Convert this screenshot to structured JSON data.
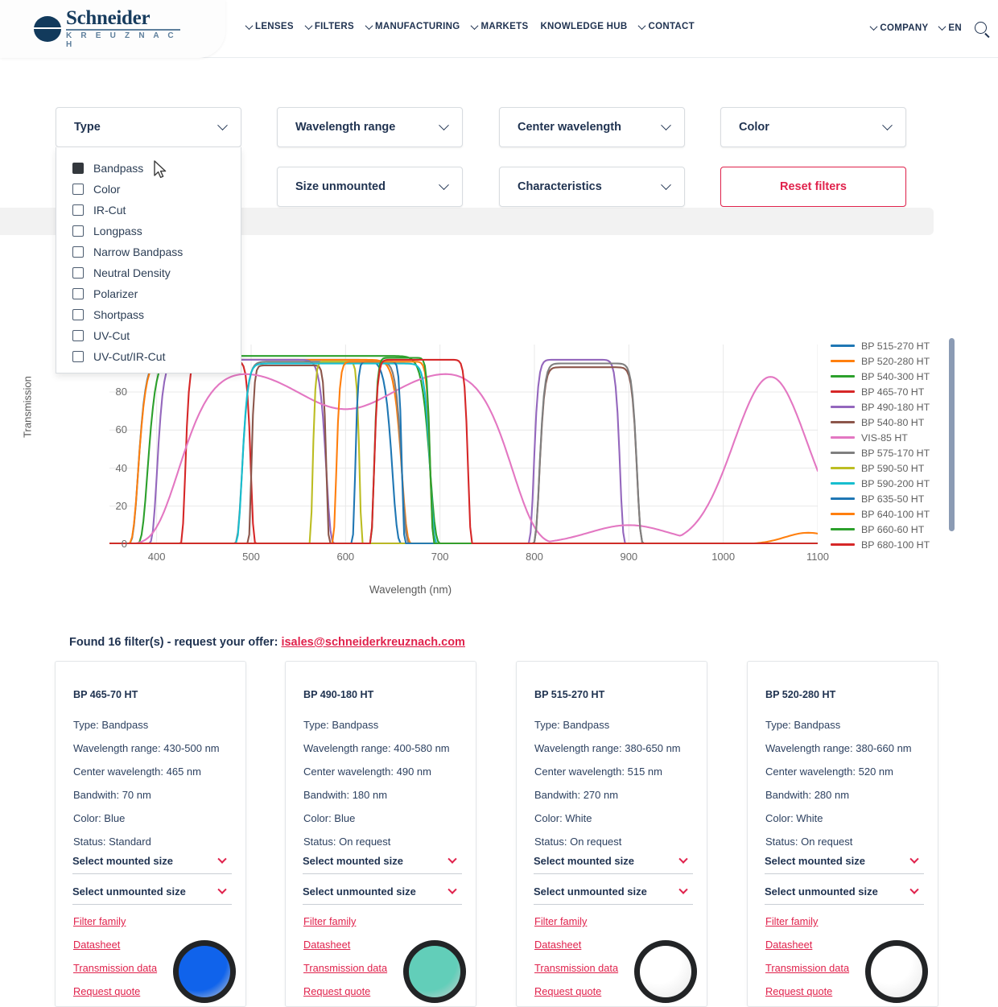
{
  "header": {
    "logo": {
      "brand": "Schneider",
      "sub": "K R E U Z N A C H"
    },
    "nav_left": [
      {
        "label": "LENSES",
        "caret": true
      },
      {
        "label": "FILTERS",
        "caret": true
      },
      {
        "label": "MANUFACTURING",
        "caret": true
      },
      {
        "label": "MARKETS",
        "caret": true
      },
      {
        "label": "KNOWLEDGE HUB",
        "caret": false
      },
      {
        "label": "CONTACT",
        "caret": true
      }
    ],
    "nav_right": [
      {
        "label": "COMPANY",
        "caret": true
      },
      {
        "label": "EN",
        "caret": true
      }
    ],
    "search_icon": "search-icon"
  },
  "filters": {
    "type": {
      "label": "Type",
      "chevron": "chevron-down-icon"
    },
    "wavelength_range": {
      "label": "Wavelength range",
      "chevron": "chevron-down-icon"
    },
    "center_wavelength": {
      "label": "Center wavelength",
      "chevron": "chevron-down-icon"
    },
    "color": {
      "label": "Color",
      "chevron": "chevron-down-icon"
    },
    "size_unmounted": {
      "label": "Size unmounted",
      "chevron": "chevron-down-icon"
    },
    "characteristics": {
      "label": "Characteristics",
      "chevron": "chevron-down-icon"
    },
    "reset": {
      "label": "Reset filters",
      "accent": "#e0224c"
    }
  },
  "type_dropdown": {
    "open": true,
    "options": [
      {
        "label": "Bandpass",
        "checked": true
      },
      {
        "label": "Color",
        "checked": false
      },
      {
        "label": "IR-Cut",
        "checked": false
      },
      {
        "label": "Longpass",
        "checked": false
      },
      {
        "label": "Narrow Bandpass",
        "checked": false
      },
      {
        "label": "Neutral Density",
        "checked": false
      },
      {
        "label": "Polarizer",
        "checked": false
      },
      {
        "label": "Shortpass",
        "checked": false
      },
      {
        "label": "UV-Cut",
        "checked": false
      },
      {
        "label": "UV-Cut/IR-Cut",
        "checked": false
      }
    ]
  },
  "chart_data": {
    "type": "line",
    "title": "",
    "xlabel": "Wavelength (nm)",
    "ylabel": "Transmission",
    "xlim": [
      350,
      1100
    ],
    "ylim": [
      0,
      105
    ],
    "xticks": [
      400,
      500,
      600,
      700,
      800,
      900,
      1000,
      1100
    ],
    "yticks": [
      0,
      20,
      40,
      60,
      80
    ],
    "grid": true,
    "legend_position": "right",
    "legend_scrollable": true,
    "series": [
      {
        "name": "BP 515-270 HT",
        "color": "#1f77b4",
        "band": [
          380,
          650
        ],
        "peak": 97
      },
      {
        "name": "BP 520-280 HT",
        "color": "#ff7f0e",
        "band": [
          380,
          660
        ],
        "peak": 97
      },
      {
        "name": "BP 540-300 HT",
        "color": "#2ca02c",
        "band": [
          390,
          690
        ],
        "peak": 99
      },
      {
        "name": "BP 465-70 HT",
        "color": "#d62728",
        "band": [
          430,
          500
        ],
        "peak": 96
      },
      {
        "name": "BP 490-180 HT",
        "color": "#9467bd",
        "band": [
          400,
          580
        ],
        "peak": 97
      },
      {
        "name": "BP 540-80 HT",
        "color": "#8c564b",
        "band": [
          500,
          580
        ],
        "peak": 94
      },
      {
        "name": "VIS-85 HT",
        "color": "#e377c2",
        "band": [
          420,
          780
        ],
        "peak": 93
      },
      {
        "name": "BP 575-170 HT",
        "color": "#7f7f7f",
        "band": [
          490,
          660
        ],
        "peak": 96
      },
      {
        "name": "BP 590-50 HT",
        "color": "#bcbd22",
        "band": [
          565,
          615
        ],
        "peak": 96
      },
      {
        "name": "BP 590-200 HT",
        "color": "#17becf",
        "band": [
          490,
          690
        ],
        "peak": 95
      },
      {
        "name": "BP 635-50 HT",
        "color": "#1f77b4",
        "band": [
          610,
          660
        ],
        "peak": 96
      },
      {
        "name": "BP 640-100 HT",
        "color": "#ff7f0e",
        "band": [
          590,
          690
        ],
        "peak": 96
      },
      {
        "name": "BP 660-60 HT",
        "color": "#2ca02c",
        "band": [
          630,
          690
        ],
        "peak": 98
      },
      {
        "name": "BP 680-100 HT",
        "color": "#d62728",
        "band": [
          630,
          730
        ],
        "peak": 97
      }
    ]
  },
  "results": {
    "found_prefix": "Found 16 filter(s) - request your offer: ",
    "email": "isales@schneiderkreuznach.com",
    "card_actions": [
      "Select mounted size",
      "Select unmounted size"
    ],
    "card_links": [
      "Filter family",
      "Datasheet",
      "Transmission data",
      "Request quote"
    ],
    "cards": [
      {
        "title": "BP 465-70 HT",
        "type": "Type: Bandpass",
        "wavelength_range": "Wavelength range: 430-500 nm",
        "center_wavelength": "Center wavelength: 465 nm",
        "bandwidth": "Bandwith: 70 nm",
        "color": "Color: Blue",
        "status": "Status: Standard",
        "swatch_color": "#1063eb"
      },
      {
        "title": "BP 490-180 HT",
        "type": "Type: Bandpass",
        "wavelength_range": "Wavelength range: 400-580 nm",
        "center_wavelength": "Center wavelength: 490 nm",
        "bandwidth": "Bandwith: 180 nm",
        "color": "Color: Blue",
        "status": "Status: On request",
        "swatch_color": "#62ceb9"
      },
      {
        "title": "BP 515-270 HT",
        "type": "Type: Bandpass",
        "wavelength_range": "Wavelength range: 380-650 nm",
        "center_wavelength": "Center wavelength: 515 nm",
        "bandwidth": "Bandwith: 270 nm",
        "color": "Color: White",
        "status": "Status: On request",
        "swatch_color": "#f7f7f7"
      },
      {
        "title": "BP 520-280 HT",
        "type": "Type: Bandpass",
        "wavelength_range": "Wavelength range: 380-660 nm",
        "center_wavelength": "Center wavelength: 520 nm",
        "bandwidth": "Bandwith: 280 nm",
        "color": "Color: White",
        "status": "Status: On request",
        "swatch_color": "#f7f7f7"
      }
    ]
  }
}
